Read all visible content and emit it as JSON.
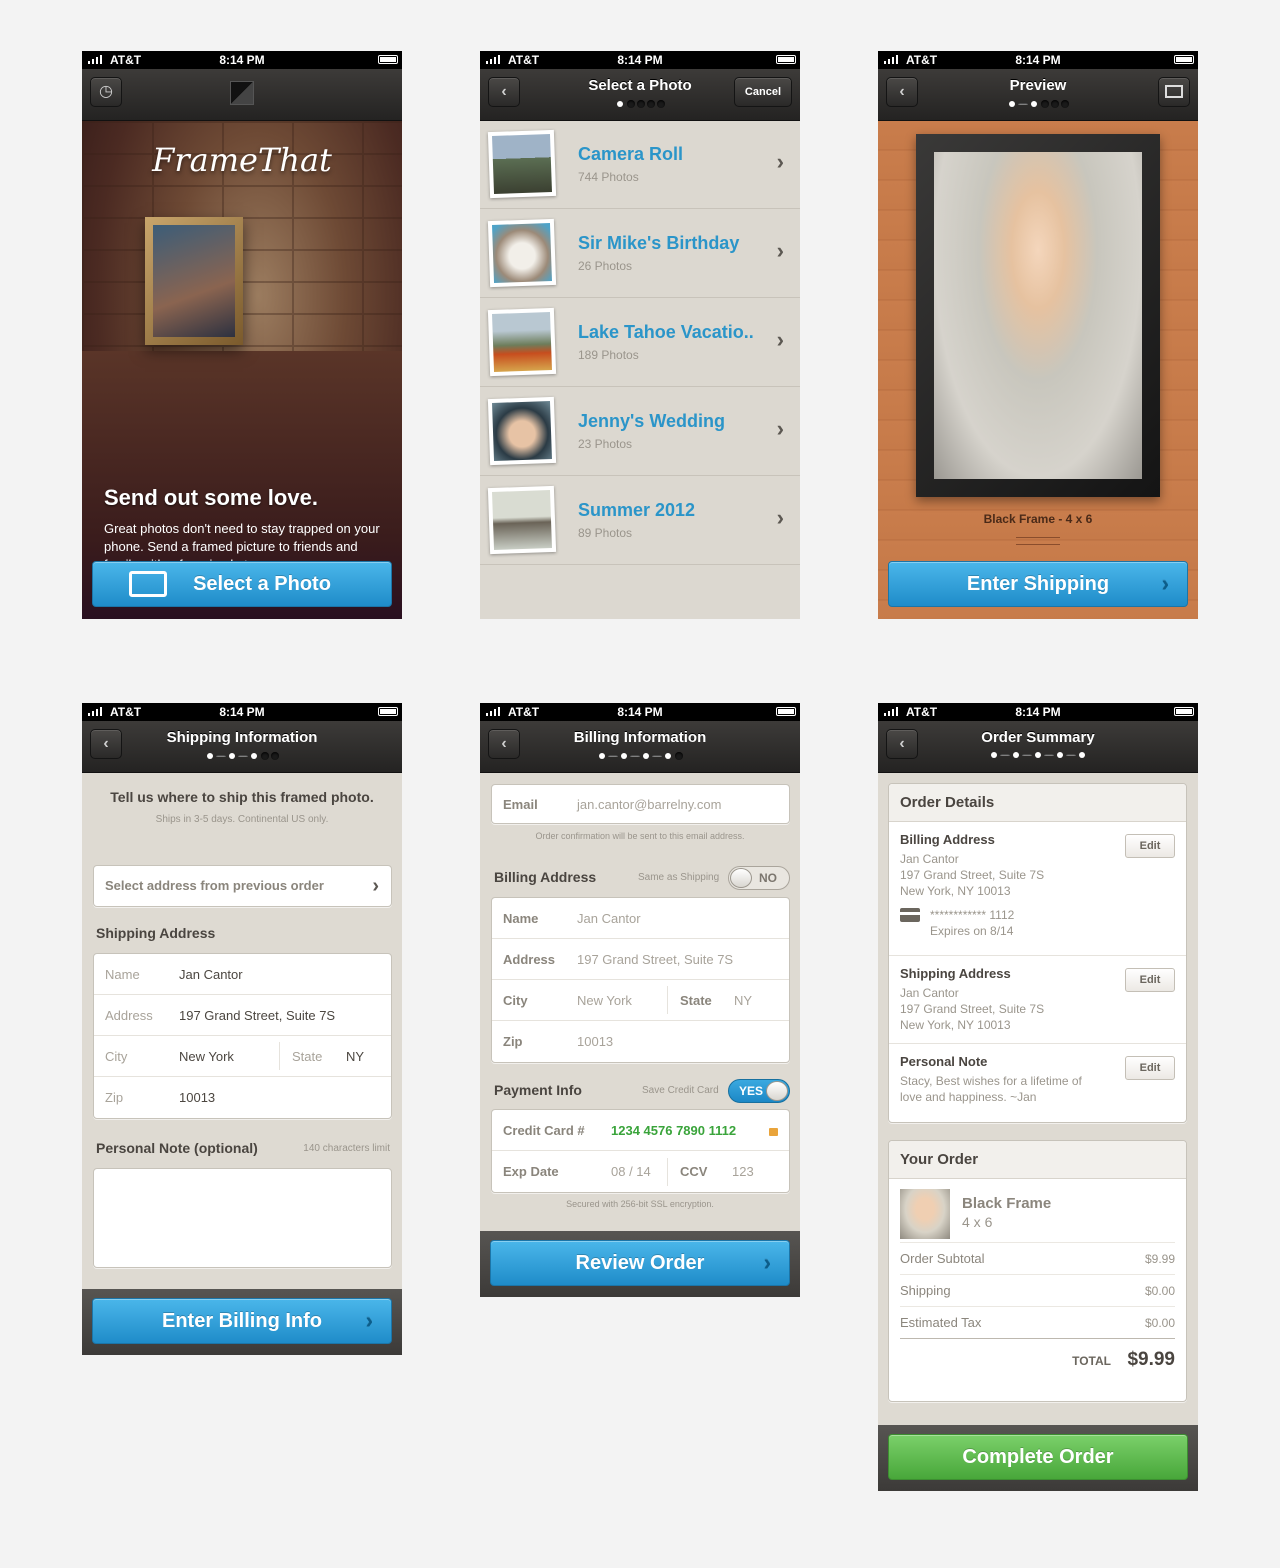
{
  "status": {
    "carrier": "AT&T",
    "time": "8:14 PM"
  },
  "screen1": {
    "logo": "FrameThat",
    "heading": "Send out some love.",
    "body": "Great photos don't need to stay trapped on your phone. Send a framed picture to friends and family with a few simple taps.",
    "button": "Select a Photo"
  },
  "screen2": {
    "title": "Select a Photo",
    "cancel": "Cancel",
    "albums": [
      {
        "name": "Camera Roll",
        "count": "744 Photos"
      },
      {
        "name": "Sir Mike's Birthday",
        "count": "26 Photos"
      },
      {
        "name": "Lake Tahoe Vacatio..",
        "count": "189 Photos"
      },
      {
        "name": "Jenny's Wedding",
        "count": "23 Photos"
      },
      {
        "name": "Summer 2012",
        "count": "89 Photos"
      }
    ]
  },
  "screen3": {
    "title": "Preview",
    "caption": "Black Frame - 4 x 6",
    "button": "Enter Shipping"
  },
  "screen4": {
    "title": "Shipping Information",
    "intro": "Tell us where to ship this framed photo.",
    "sub": "Ships in 3-5 days. Continental US only.",
    "previous": "Select address from previous order",
    "section": "Shipping Address",
    "fields": {
      "name_label": "Name",
      "name": "Jan Cantor",
      "address_label": "Address",
      "address": "197 Grand Street, Suite 7S",
      "city_label": "City",
      "city": "New York",
      "state_label": "State",
      "state": "NY",
      "zip_label": "Zip",
      "zip": "10013"
    },
    "note_label": "Personal Note (optional)",
    "note_limit": "140 characters limit",
    "button": "Enter Billing Info"
  },
  "screen5": {
    "title": "Billing Information",
    "email_label": "Email",
    "email": "jan.cantor@barrelny.com",
    "email_note": "Order confirmation will be sent to this email address.",
    "billing_section": "Billing Address",
    "same_label": "Same as Shipping",
    "same_toggle": "NO",
    "fields": {
      "name_label": "Name",
      "name": "Jan Cantor",
      "address_label": "Address",
      "address": "197 Grand Street, Suite 7S",
      "city_label": "City",
      "city": "New York",
      "state_label": "State",
      "state": "NY",
      "zip_label": "Zip",
      "zip": "10013"
    },
    "payment_section": "Payment Info",
    "save_label": "Save Credit Card",
    "save_toggle": "YES",
    "cc_label": "Credit Card #",
    "cc": "1234 4576 7890 1112",
    "exp_label": "Exp Date",
    "exp": "08 / 14",
    "ccv_label": "CCV",
    "ccv": "123",
    "secure": "Secured with 256-bit SSL encryption.",
    "button": "Review Order"
  },
  "screen6": {
    "title": "Order Summary",
    "details_head": "Order Details",
    "billing_head": "Billing Address",
    "billing_lines": [
      "Jan Cantor",
      "197 Grand Street, Suite 7S",
      "New York, NY 10013"
    ],
    "card_masked": "************ 1112",
    "card_expires": "Expires on 8/14",
    "shipping_head": "Shipping Address",
    "shipping_lines": [
      "Jan Cantor",
      "197 Grand Street, Suite 7S",
      "New York, NY 10013"
    ],
    "note_head": "Personal Note",
    "note": "Stacy, Best wishes for a lifetime of love and happiness. ~Jan",
    "edit": "Edit",
    "order_head": "Your Order",
    "product": "Black Frame",
    "size": "4 x 6",
    "subtotal_label": "Order Subtotal",
    "subtotal": "$9.99",
    "shipping_label": "Shipping",
    "shipping": "$0.00",
    "tax_label": "Estimated Tax",
    "tax": "$0.00",
    "total_label": "TOTAL",
    "total": "$9.99",
    "button": "Complete Order"
  }
}
